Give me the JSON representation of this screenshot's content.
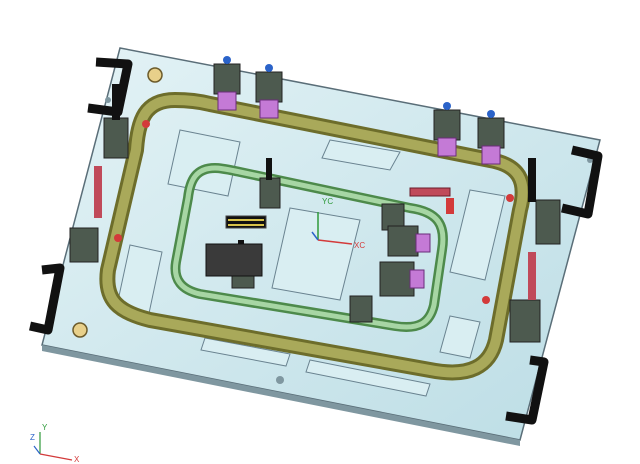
{
  "colors": {
    "background": "#ffffff",
    "base_plate": "#cfe8ee",
    "base_plate_edge": "#5a6e78",
    "outer_tube": "#8a8a3a",
    "inner_tube": "#8cc08a",
    "clamp_body": "#4d5a4f",
    "clamp_handle": "#111111",
    "cylinder": "#c47ad6",
    "red_accent": "#d33a3a",
    "blue_cap": "#2b63c9"
  },
  "axis_triad_local": {
    "y_label": "YC",
    "x_label": "XC"
  },
  "axis_triad_global": {
    "z_label": "Z",
    "y_label": "Y",
    "x_label": "X"
  }
}
